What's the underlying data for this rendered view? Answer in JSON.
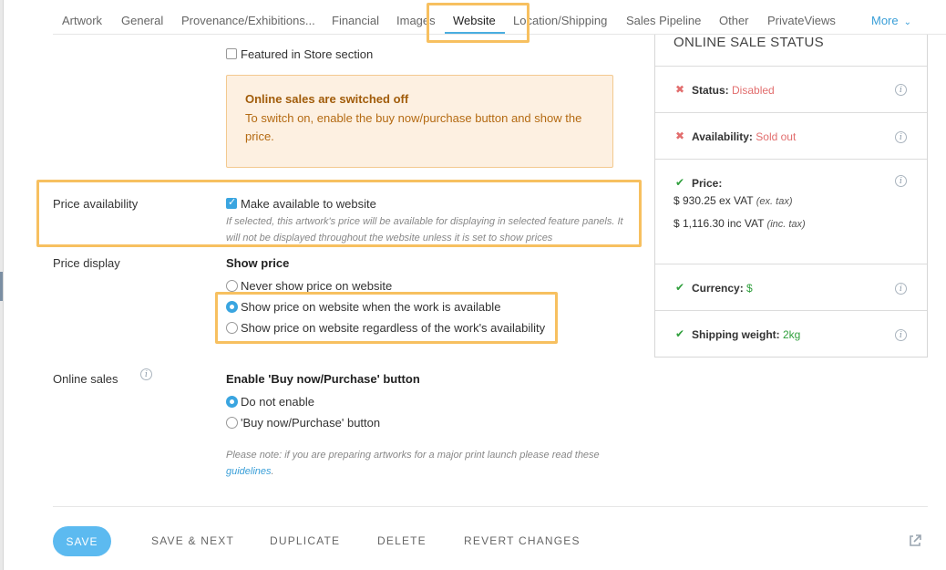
{
  "tabs": [
    {
      "label": "Artwork"
    },
    {
      "label": "General"
    },
    {
      "label": "Provenance/Exhibitions..."
    },
    {
      "label": "Financial"
    },
    {
      "label": "Images"
    },
    {
      "label": "Website",
      "active": true
    },
    {
      "label": "Location/Shipping"
    },
    {
      "label": "Sales Pipeline"
    },
    {
      "label": "Other"
    },
    {
      "label": "PrivateViews"
    }
  ],
  "more_label": "More",
  "featured_store": {
    "label": "Featured in Store section",
    "checked": false
  },
  "alert": {
    "title": "Online sales are switched off",
    "body": "To switch on, enable the buy now/purchase button and show the price."
  },
  "price_availability": {
    "label": "Price availability",
    "checkbox_label": "Make available to website",
    "checked": true,
    "help": "If selected, this artwork's price will be available for displaying in selected feature panels. It will not be displayed throughout the website unless it is set to show prices"
  },
  "price_display": {
    "label": "Price display",
    "heading": "Show price",
    "options": [
      {
        "label": "Never show price on website",
        "selected": false
      },
      {
        "label": "Show price on website when the work is available",
        "selected": true
      },
      {
        "label": "Show price on website regardless of the work's availability",
        "selected": false
      }
    ]
  },
  "online_sales": {
    "label": "Online sales",
    "heading": "Enable 'Buy now/Purchase' button",
    "options": [
      {
        "label": "Do not enable",
        "selected": true
      },
      {
        "label": "'Buy now/Purchase' button",
        "selected": false
      }
    ],
    "note_prefix": "Please note: if you are preparing artworks for a major print launch please read these ",
    "note_link": "guidelines",
    "note_suffix": "."
  },
  "status_panel": {
    "title": "ONLINE SALE STATUS",
    "status": {
      "key": "Status:",
      "value": "Disabled",
      "ok": false
    },
    "availability": {
      "key": "Availability:",
      "value": "Sold out",
      "ok": false
    },
    "price": {
      "key": "Price:",
      "ok": true,
      "ex_vat": "$ 930.25 ex VAT",
      "ex_tax": "(ex. tax)",
      "inc_vat": "$ 1,116.30 inc VAT",
      "inc_tax": "(inc. tax)"
    },
    "currency": {
      "key": "Currency:",
      "value": "$",
      "ok": true
    },
    "shipping": {
      "key": "Shipping weight:",
      "value": "2kg",
      "ok": true
    }
  },
  "actions": {
    "save": "SAVE",
    "save_next": "SAVE & NEXT",
    "duplicate": "DUPLICATE",
    "delete": "DELETE",
    "revert": "REVERT CHANGES"
  },
  "icons": {
    "info": "info-circle-icon",
    "cross": "cross-icon",
    "check": "check-icon",
    "external": "external-link-icon",
    "chevron": "chevron-down-icon"
  },
  "colors": {
    "accent": "#3aa5e0",
    "highlight": "#f7c060",
    "alert_bg": "#fdf0e1",
    "danger": "#e26e6e",
    "success": "#2f9f3c"
  }
}
